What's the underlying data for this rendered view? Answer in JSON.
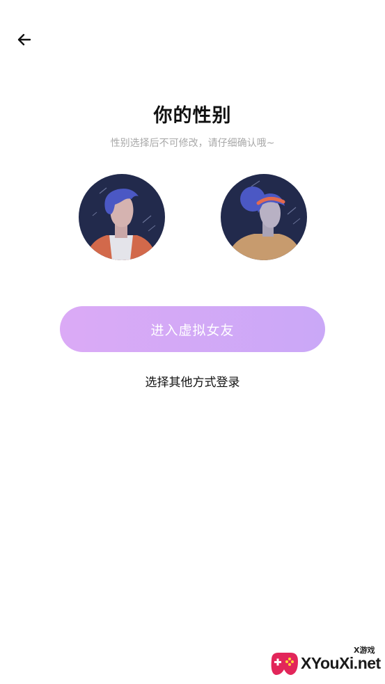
{
  "header": {
    "back_icon": "arrow-left-icon"
  },
  "main": {
    "title": "你的性别",
    "subtitle": "性别选择后不可修改，请仔细确认哦~",
    "avatars": [
      {
        "gender": "male",
        "icon": "male-avatar"
      },
      {
        "gender": "female",
        "icon": "female-avatar"
      }
    ],
    "enter_button_label": "进入虚拟女友",
    "other_login_label": "选择其他方式登录"
  },
  "watermark": {
    "small_text": "X游戏",
    "main_text": "XYouXi.net"
  },
  "colors": {
    "button_gradient_start": "#dbaaf6",
    "button_gradient_end": "#caa8f7",
    "avatar_bg": "#232a4d",
    "title_color": "#111111",
    "subtitle_color": "#a8a8a8"
  }
}
